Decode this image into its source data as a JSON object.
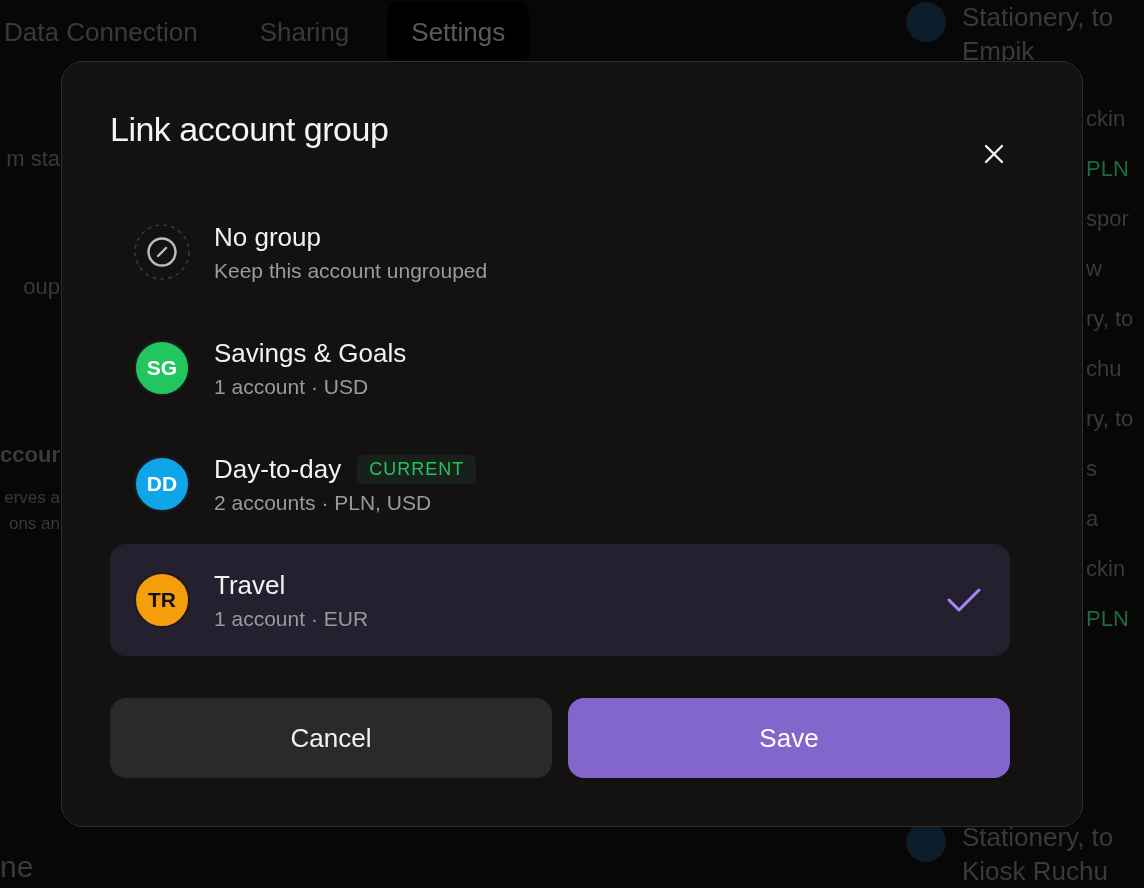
{
  "background": {
    "tabs": [
      {
        "label": "Data Connection",
        "selected": false
      },
      {
        "label": "Sharing",
        "selected": false
      },
      {
        "label": "Settings",
        "selected": true
      }
    ],
    "left_fragments": [
      {
        "text": "m sta",
        "kind": "heading"
      },
      {
        "text": "oup",
        "kind": "heading"
      },
      {
        "text": "ccour",
        "kind": "title"
      },
      {
        "text": "erves a",
        "kind": "small"
      },
      {
        "text": "ons an",
        "kind": "small"
      }
    ],
    "left_bottom": "ne",
    "right_top": {
      "title": "Stationery, to",
      "subtitle": "Empik"
    },
    "right_fragments": [
      {
        "text": "ckin",
        "kind": "text"
      },
      {
        "text": "PLN",
        "kind": "amount"
      },
      {
        "text": "spor",
        "kind": "text"
      },
      {
        "text": "w",
        "kind": "text"
      },
      {
        "text": "ry, to",
        "kind": "text"
      },
      {
        "text": "chu",
        "kind": "text"
      },
      {
        "text": "ry, to",
        "kind": "text"
      },
      {
        "text": "s",
        "kind": "text"
      },
      {
        "text": "a",
        "kind": "text"
      },
      {
        "text": "ckin",
        "kind": "text"
      },
      {
        "text": "PLN",
        "kind": "amount"
      }
    ],
    "right_bottom": {
      "title": "Stationery, to",
      "subtitle": "Kiosk Ruchu"
    }
  },
  "dialog": {
    "title": "Link account group",
    "options": [
      {
        "kind": "none",
        "title": "No group",
        "subtitle": "Keep this account ungrouped",
        "selected": false
      },
      {
        "kind": "group",
        "initials": "SG",
        "color": "#22c55e",
        "title": "Savings & Goals",
        "subtitle": "1 account · USD",
        "selected": false
      },
      {
        "kind": "group",
        "initials": "DD",
        "color": "#0ea5e9",
        "title": "Day-to-day",
        "badge": "CURRENT",
        "subtitle": "2 accounts · PLN, USD",
        "selected": false
      },
      {
        "kind": "group",
        "initials": "TR",
        "color": "#f59e0b",
        "title": "Travel",
        "subtitle": "1 account · EUR",
        "selected": true
      }
    ],
    "buttons": [
      {
        "label": "Cancel",
        "kind": "secondary"
      },
      {
        "label": "Save",
        "kind": "primary"
      }
    ]
  }
}
